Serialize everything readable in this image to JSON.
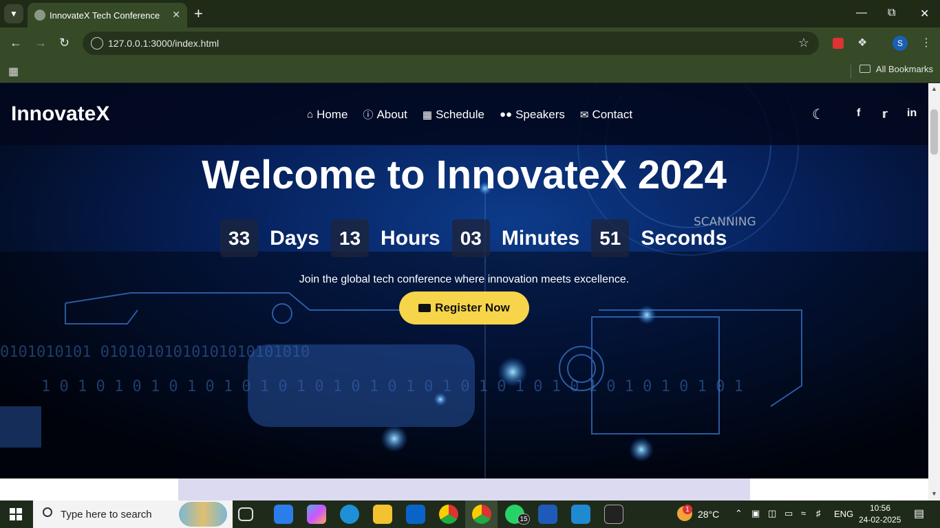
{
  "browser": {
    "tab_title": "InnovateX Tech Conference",
    "url": "127.0.0.1:3000/index.html",
    "bookmarks_label": "All Bookmarks",
    "profile_initial": "S"
  },
  "site": {
    "logo": "InnovateX",
    "nav": [
      {
        "label": "Home",
        "icon": "home-icon"
      },
      {
        "label": "About",
        "icon": "info-icon"
      },
      {
        "label": "Schedule",
        "icon": "calendar-icon"
      },
      {
        "label": "Speakers",
        "icon": "users-icon"
      },
      {
        "label": "Contact",
        "icon": "envelope-icon"
      }
    ],
    "social": [
      "facebook-icon",
      "twitter-icon",
      "linkedin-icon"
    ]
  },
  "hero": {
    "title": "Welcome to InnovateX 2024",
    "countdown": [
      {
        "value": "33",
        "unit": "Days"
      },
      {
        "value": "13",
        "unit": "Hours"
      },
      {
        "value": "03",
        "unit": "Minutes"
      },
      {
        "value": "51",
        "unit": "Seconds"
      }
    ],
    "tagline": "Join the global tech conference where innovation meets excellence.",
    "cta": "Register Now",
    "bg_text": "SCANNING"
  },
  "taskbar": {
    "search_placeholder": "Type here to search",
    "whatsapp_badge": "15",
    "weather_badge": "1",
    "temperature": "28°C",
    "language": "ENG",
    "time": "10:56",
    "date": "24-02-2025"
  },
  "colors": {
    "cta": "#f7d54a",
    "browser_frame": "#364a28"
  }
}
